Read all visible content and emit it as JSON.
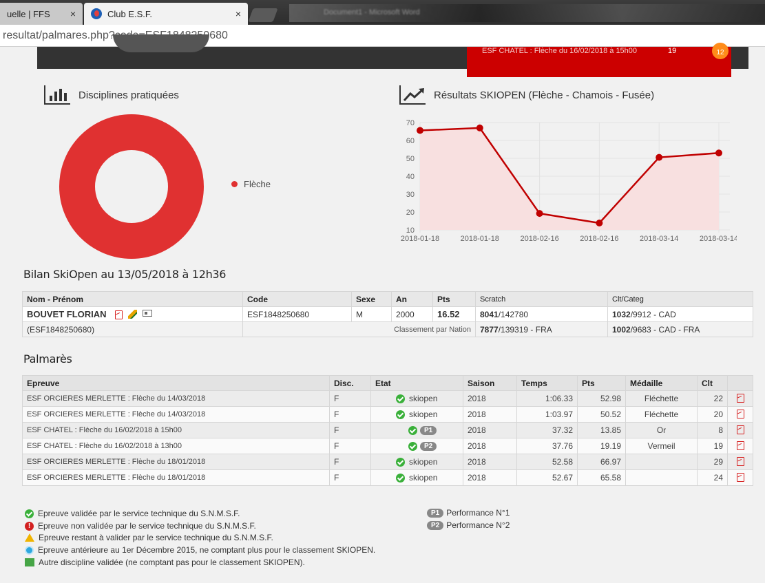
{
  "browser": {
    "tab1_title": "uelle | FFS",
    "tab2_title": "Club E.S.F.",
    "tab_close": "×",
    "bg_window_title": "Document1 - Microsoft Word",
    "url": "resultat/palmares.php?code=ESF1848250680"
  },
  "header": {
    "notification_text": "ESF CHATEL : Flèche du 16/02/2018 à 15h00",
    "notification_count": "19",
    "notification_badge": "12"
  },
  "disciplines": {
    "title": "Disciplines pratiquées",
    "legend": "Flèche",
    "color": "#e03131"
  },
  "results_chart": {
    "title": "Résultats SKIOPEN (Flèche - Chamois - Fusée)"
  },
  "chart_data": {
    "type": "line",
    "title": "Résultats SKIOPEN (Flèche - Chamois - Fusée)",
    "categories": [
      "2018-01-18",
      "2018-01-18",
      "2018-02-16",
      "2018-02-16",
      "2018-03-14",
      "2018-03-14"
    ],
    "values": [
      65.58,
      66.97,
      19.19,
      13.85,
      50.52,
      52.98
    ],
    "yticks": [
      "10",
      "20",
      "30",
      "40",
      "50",
      "60",
      "70"
    ],
    "ylim": [
      10,
      70
    ],
    "grid": true,
    "color": "#c00000",
    "fill": "#f8e0e0"
  },
  "bilan": {
    "title": "Bilan SkiOpen au 13/05/2018 à 12h36",
    "headers": [
      "Nom - Prénom",
      "Code",
      "Sexe",
      "An",
      "Pts",
      "Scratch",
      "Clt/Categ"
    ],
    "name": "BOUVET FLORIAN",
    "code": "ESF1848250680",
    "sexe": "M",
    "an": "2000",
    "pts": "16.52",
    "scratch_rank": "8041",
    "scratch_total": "/142780",
    "categ_rank": "1032",
    "categ_total": "/9912 - CAD",
    "code_paren": "(ESF1848250680)",
    "nation_label": "Classement par Nation",
    "nation_rank": "7877",
    "nation_total": "/139319 - FRA",
    "nation_categ_rank": "1002",
    "nation_categ_total": "/9683 - CAD - FRA"
  },
  "palmares": {
    "title": "Palmarès",
    "headers": [
      "Epreuve",
      "Disc.",
      "Etat",
      "Saison",
      "Temps",
      "Pts",
      "Médaille",
      "Clt"
    ],
    "rows": [
      {
        "epreuve": "ESF ORCIERES MERLETTE : Flèche du 14/03/2018",
        "disc": "F",
        "etat": "skiopen",
        "saison": "2018",
        "temps": "1:06.33",
        "pts": "52.98",
        "medaille": "Fléchette",
        "clt": "22"
      },
      {
        "epreuve": "ESF ORCIERES MERLETTE : Flèche du 14/03/2018",
        "disc": "F",
        "etat": "skiopen",
        "saison": "2018",
        "temps": "1:03.97",
        "pts": "50.52",
        "medaille": "Fléchette",
        "clt": "20"
      },
      {
        "epreuve": "ESF CHATEL : Flèche du 16/02/2018 à 15h00",
        "disc": "F",
        "etat": "P1",
        "saison": "2018",
        "temps": "37.32",
        "pts": "13.85",
        "medaille": "Or",
        "clt": "8"
      },
      {
        "epreuve": "ESF CHATEL : Flèche du 16/02/2018 à 13h00",
        "disc": "F",
        "etat": "P2",
        "saison": "2018",
        "temps": "37.76",
        "pts": "19.19",
        "medaille": "Vermeil",
        "clt": "19"
      },
      {
        "epreuve": "ESF ORCIERES MERLETTE : Flèche du 18/01/2018",
        "disc": "F",
        "etat": "skiopen",
        "saison": "2018",
        "temps": "52.58",
        "pts": "66.97",
        "medaille": "",
        "clt": "29"
      },
      {
        "epreuve": "ESF ORCIERES MERLETTE : Flèche du 18/01/2018",
        "disc": "F",
        "etat": "skiopen",
        "saison": "2018",
        "temps": "52.67",
        "pts": "65.58",
        "medaille": "",
        "clt": "24"
      }
    ]
  },
  "legend": {
    "validated": "Epreuve validée par le service technique du S.N.M.S.F.",
    "not_validated": "Epreuve non validée par le service technique du S.N.M.S.F.",
    "pending": "Epreuve restant à valider par le service technique du S.N.M.S.F.",
    "prior": "Epreuve antérieure au 1er Décembre 2015, ne comptant plus pour le classement SKIOPEN.",
    "other": "Autre discipline validée (ne comptant pas pour le classement SKIOPEN).",
    "p1_badge": "P1",
    "p1_text": "Performance N°1",
    "p2_badge": "P2",
    "p2_text": "Performance N°2"
  }
}
